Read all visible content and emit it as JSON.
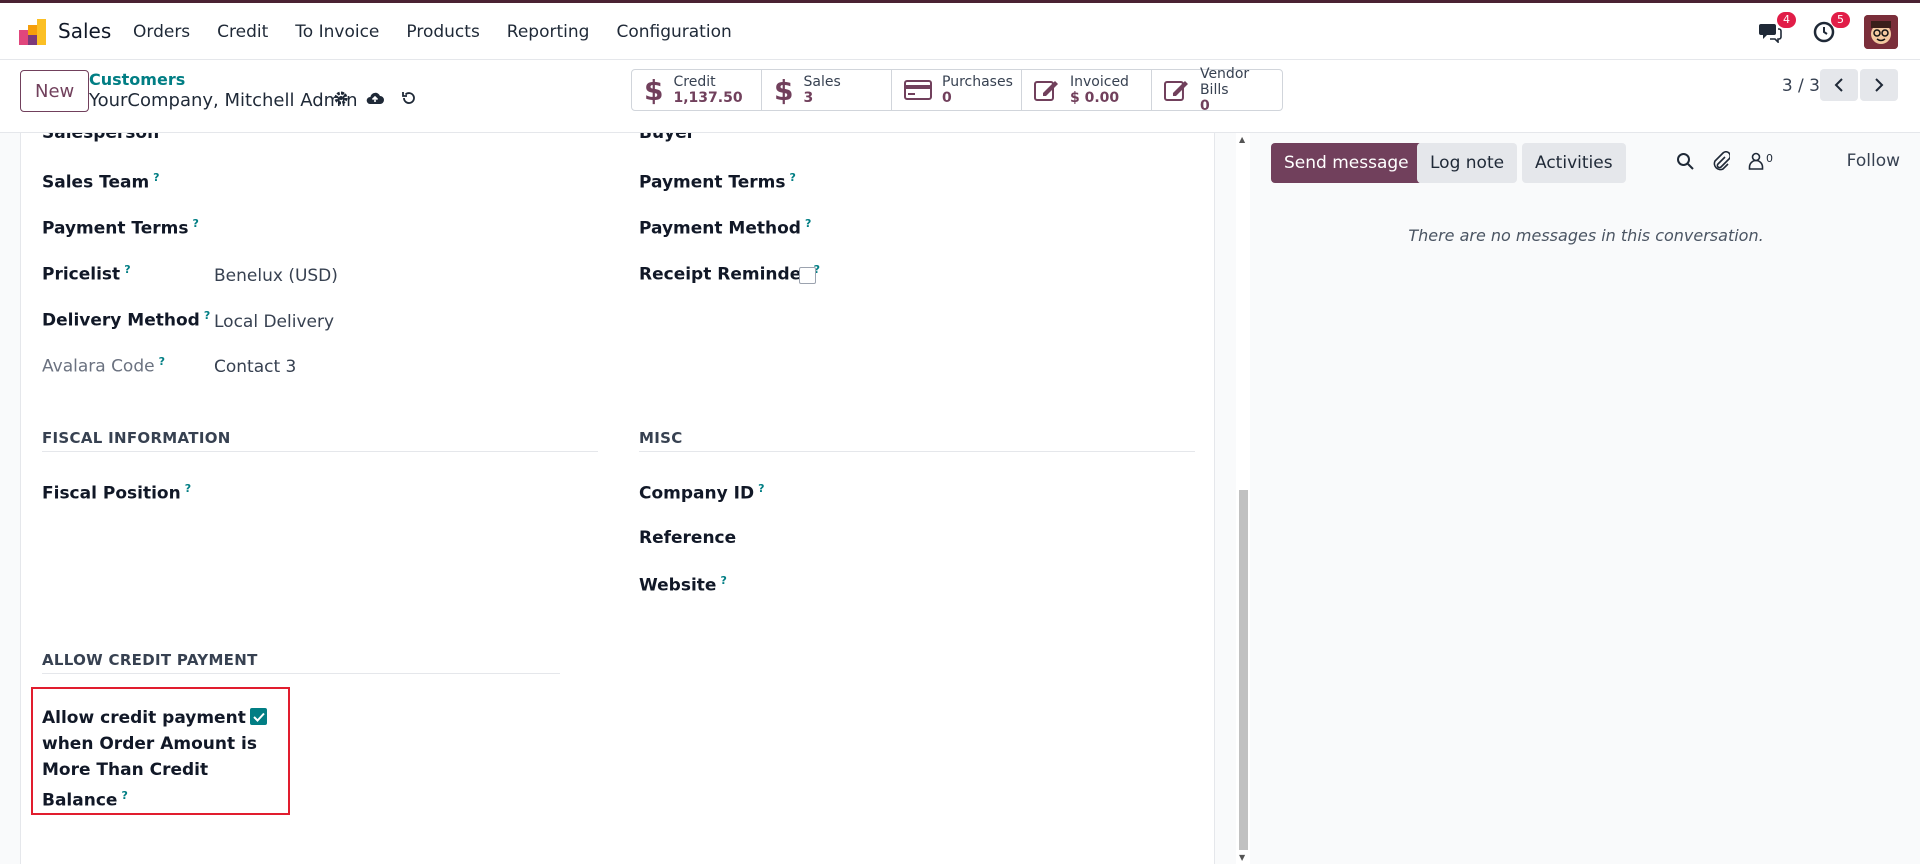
{
  "app": {
    "name": "Sales"
  },
  "menu": [
    "Orders",
    "Credit",
    "To Invoice",
    "Products",
    "Reporting",
    "Configuration"
  ],
  "nav": {
    "messages_count": "4",
    "activities_count": "5"
  },
  "control": {
    "new_label": "New",
    "breadcrumb": "Customers",
    "record_name": "YourCompany, Mitchell Admin",
    "pager": "3 / 3"
  },
  "stats": [
    {
      "label": "Credit",
      "value": "1,137.50"
    },
    {
      "label": "Sales",
      "value": "3"
    },
    {
      "label": "Purchases",
      "value": "0"
    },
    {
      "label": "Invoiced",
      "value": "$ 0.00"
    },
    {
      "label": "Vendor Bills",
      "value": "0"
    }
  ],
  "form": {
    "left": {
      "salesperson": "Salesperson",
      "sales_team": "Sales Team",
      "payment_terms": "Payment Terms",
      "pricelist": "Pricelist",
      "pricelist_value": "Benelux (USD)",
      "delivery_method": "Delivery Method",
      "delivery_method_value": "Local Delivery",
      "avalara_code": "Avalara Code",
      "avalara_code_value": "Contact 3"
    },
    "right": {
      "buyer": "Buyer",
      "payment_terms": "Payment Terms",
      "payment_method": "Payment Method",
      "receipt_reminder": "Receipt Reminder"
    },
    "fiscal_section": "FISCAL INFORMATION",
    "fiscal_position": "Fiscal Position",
    "misc_section": "MISC",
    "company_id": "Company ID",
    "reference": "Reference",
    "website": "Website",
    "credit_section": "ALLOW CREDIT PAYMENT",
    "credit_line1": "Allow credit payment",
    "credit_line2": "when Order Amount is",
    "credit_line3": "More Than Credit",
    "credit_line4": "Balance",
    "help_mark": "?"
  },
  "chatter": {
    "send_message": "Send message",
    "log_note": "Log note",
    "activities": "Activities",
    "followers_count": "0",
    "follow": "Follow",
    "empty": "There are no messages in this conversation."
  },
  "colors": {
    "brand": "#71405c",
    "accent": "#017e84",
    "highlight": "#e11d2e"
  }
}
